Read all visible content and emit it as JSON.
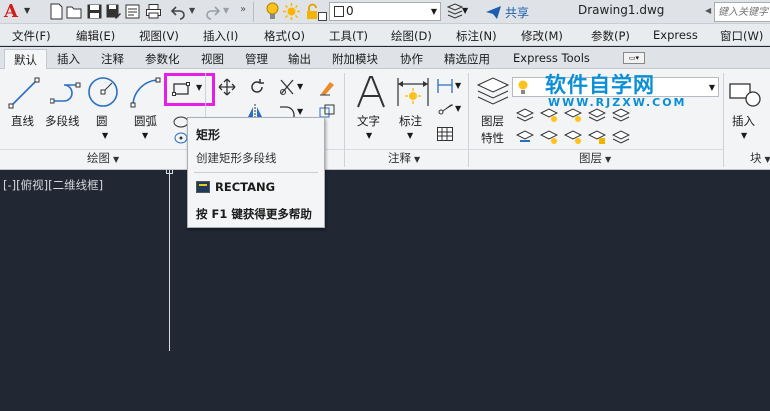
{
  "app": {
    "title": "Drawing1.dwg"
  },
  "quick_access": {
    "icons": [
      "new-icon",
      "open-icon",
      "save-icon",
      "save-as-icon",
      "print-icon",
      "undo-icon",
      "redo-icon",
      "lightbulb-icon",
      "sun-icon",
      "lock-icon"
    ],
    "layer_value": "0",
    "share_label": "共享",
    "search_placeholder": "键入关键字"
  },
  "menu": [
    "文件(F)",
    "编辑(E)",
    "视图(V)",
    "插入(I)",
    "格式(O)",
    "工具(T)",
    "绘图(D)",
    "标注(N)",
    "修改(M)",
    "参数(P)",
    "Express",
    "窗口(W)"
  ],
  "tabs": [
    "默认",
    "插入",
    "注释",
    "参数化",
    "视图",
    "管理",
    "输出",
    "附加模块",
    "协作",
    "精选应用",
    "Express Tools"
  ],
  "ribbon": {
    "draw": {
      "line": "直线",
      "polyline": "多段线",
      "circle": "圆",
      "arc": "圆弧",
      "footer": "绘图"
    },
    "annotation": {
      "text": "文字",
      "dimension": "标注",
      "footer": "注释"
    },
    "layers": {
      "properties_line1": "图层",
      "properties_line2": "特性",
      "footer": "图层"
    },
    "block": {
      "insert": "插入",
      "footer": "块"
    }
  },
  "watermark": {
    "name": "软件自学网",
    "url": "WWW.RJZXW.COM"
  },
  "viewport_label": "[-][俯视][二维线框]",
  "tooltip": {
    "title": "矩形",
    "description": "创建矩形多段线",
    "command": "RECTANG",
    "help": "按 F1 键获得更多帮助"
  },
  "colors": {
    "canvas": "#212833",
    "highlight": "#e61ee6",
    "share": "#1d5fae",
    "watermark": "#0a8fd6"
  }
}
